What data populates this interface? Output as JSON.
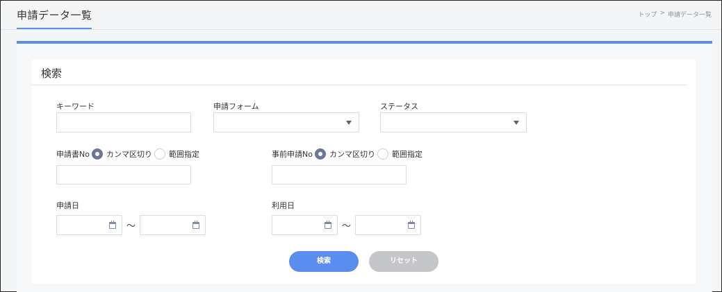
{
  "header": {
    "title": "申請データ一覧",
    "breadcrumb": [
      {
        "label": "トップ"
      },
      {
        "label": ">"
      },
      {
        "label": "申請データ一覧"
      }
    ]
  },
  "search_card": {
    "title": "検索",
    "keyword": {
      "label": "キーワード",
      "value": ""
    },
    "form": {
      "label": "申請フォーム",
      "selected": ""
    },
    "status": {
      "label": "ステータス",
      "selected": ""
    },
    "application_no": {
      "label": "申請書No",
      "options": [
        "カンマ区切り",
        "範囲指定"
      ],
      "selected_index": 0,
      "value": ""
    },
    "prior_application_no": {
      "label": "事前申請No",
      "options": [
        "カンマ区切り",
        "範囲指定"
      ],
      "selected_index": 0,
      "value": ""
    },
    "application_date": {
      "label": "申請日",
      "from": "",
      "to": "",
      "separator": "～"
    },
    "usage_date": {
      "label": "利用日",
      "from": "",
      "to": "",
      "separator": "～"
    },
    "buttons": {
      "search": "検索",
      "reset": "リセット"
    }
  },
  "colors": {
    "accent": "#5b8def",
    "radio_checked": "#6b7794",
    "reset_button": "#c4c6c9"
  }
}
